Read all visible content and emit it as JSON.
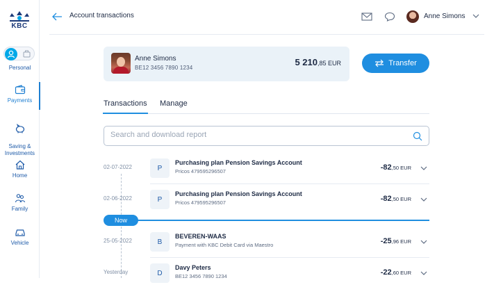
{
  "brand": {
    "logo_text": "KBC"
  },
  "sidebar": {
    "items": [
      {
        "label": "Personal",
        "icon": "person-icon"
      },
      {
        "label": "Payments",
        "icon": "wallet-icon"
      },
      {
        "label": "Saving &\nInvestments",
        "icon": "piggy-bank-icon"
      },
      {
        "label": "Home",
        "icon": "house-icon"
      },
      {
        "label": "Family",
        "icon": "family-icon"
      },
      {
        "label": "Vehicle",
        "icon": "car-icon"
      }
    ]
  },
  "header": {
    "title": "Account transactions",
    "user_name": "Anne Simons"
  },
  "account": {
    "holder": "Anne Simons",
    "iban": "BE12 3456 7890 1234",
    "balance_int": "5 210",
    "balance_dec": ",85 EUR"
  },
  "actions": {
    "transfer_label": "Transfer"
  },
  "tabs": [
    {
      "label": "Transactions",
      "active": true
    },
    {
      "label": "Manage",
      "active": false
    }
  ],
  "search": {
    "placeholder": "Search and download report"
  },
  "now_label": "Now",
  "transactions": [
    {
      "date": "02-07-2022",
      "letter": "P",
      "title": "Purchasing plan Pension Savings Account",
      "sub": "Pricos 479595296507",
      "amount_int": "-82",
      "amount_dec": ",50 EUR"
    },
    {
      "date": "02-06-2022",
      "letter": "P",
      "title": "Purchasing plan Pension Savings Account",
      "sub": "Pricos 479595296507",
      "amount_int": "-82",
      "amount_dec": ",50 EUR"
    },
    {
      "date": "25-05-2022",
      "letter": "B",
      "title": "BEVEREN-WAAS",
      "sub": "Payment with KBC Debit Card via Maestro",
      "amount_int": "-25",
      "amount_dec": ",96 EUR"
    },
    {
      "date": "Yesterday",
      "letter": "D",
      "title": "Davy Peters",
      "sub": "BE12 3456 7890 1234",
      "amount_int": "-22",
      "amount_dec": ",60 EUR"
    }
  ],
  "colors": {
    "accent": "#1f8ee0",
    "brand": "#1c3a79",
    "card_bg": "#eaf2f8"
  }
}
